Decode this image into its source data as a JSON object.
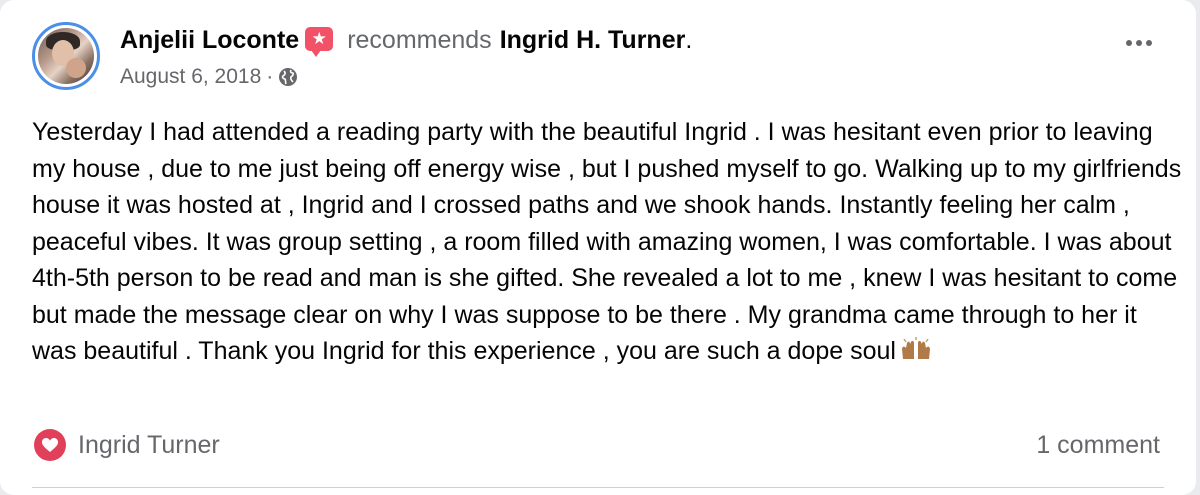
{
  "post": {
    "author": "Anjelii Loconte",
    "recommends_text": "recommends",
    "target": "Ingrid H. Turner",
    "target_suffix": ".",
    "date": "August 6, 2018",
    "separator": "·",
    "body": "Yesterday I had attended a reading party with the beautiful Ingrid . I was hesitant even prior to leaving my house , due to me just being off energy wise , but I pushed myself to go. Walking up to my girlfriends house it was hosted at , Ingrid and I crossed paths and we shook hands. Instantly feeling her calm , peaceful vibes. It was group setting , a room filled with amazing women, I was comfortable. I was about 4th-5th person to be read and man is she gifted. She revealed a lot to me , knew I was hesitant to come but made the message clear on why I was suppose to be there . My grandma came through to her it was beautiful . Thank you Ingrid for this experience , you are such a dope soul",
    "icons": {
      "avatar": "profile-photo",
      "badge": "recommendation-star-icon",
      "privacy": "globe-icon",
      "menu": "more-options-icon",
      "reaction": "heart-icon",
      "emoji": "raising-hands-emoji"
    }
  },
  "footer": {
    "reactor": "Ingrid Turner",
    "comments": "1 comment"
  },
  "colors": {
    "avatar_ring": "#4b8fe6",
    "badge": "#f25268",
    "heart": "#e0405a",
    "secondary_text": "#65676b"
  }
}
